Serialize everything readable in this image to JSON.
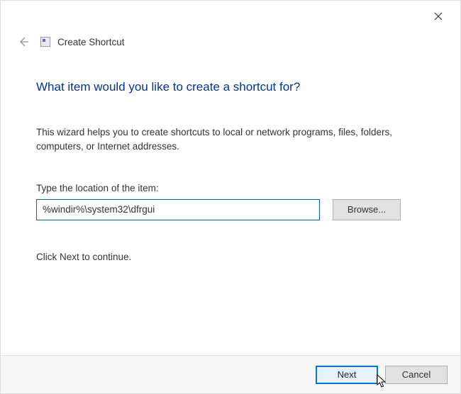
{
  "window": {
    "title": "Create Shortcut"
  },
  "wizard": {
    "headline": "What item would you like to create a shortcut for?",
    "description": "This wizard helps you to create shortcuts to local or network programs, files, folders, computers, or Internet addresses.",
    "location_label": "Type the location of the item:",
    "location_value": "%windir%\\system32\\dfrgui",
    "browse_label": "Browse...",
    "continue_hint": "Click Next to continue."
  },
  "footer": {
    "next_label": "Next",
    "cancel_label": "Cancel"
  }
}
